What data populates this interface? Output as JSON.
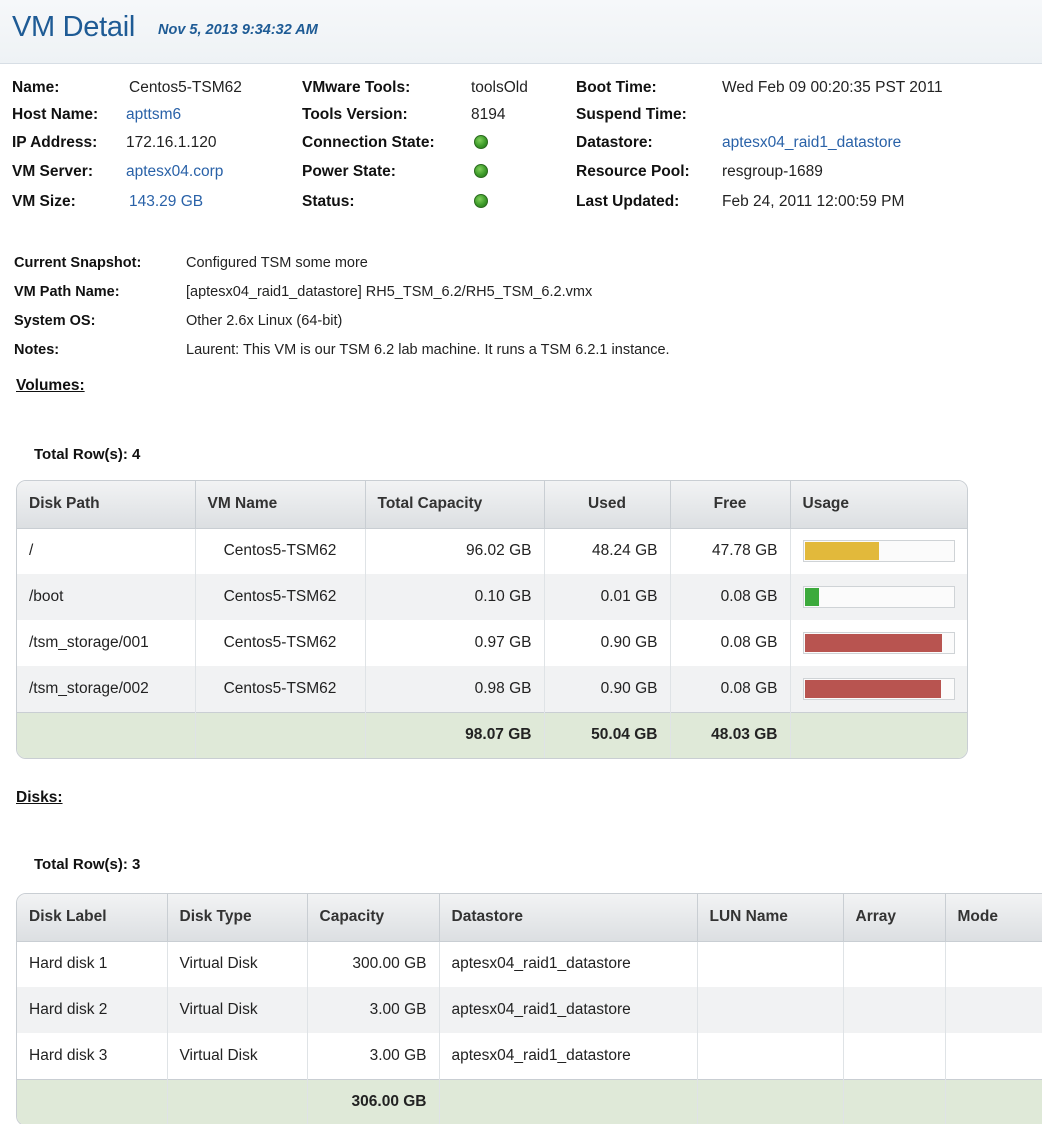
{
  "header": {
    "title": "VM Detail",
    "timestamp": "Nov 5, 2013 9:34:32 AM"
  },
  "details": {
    "col1": [
      {
        "label": "Name:",
        "value": "Centos5-TSM62",
        "link": false
      },
      {
        "label": "Host Name:",
        "value": "apttsm6",
        "link": true
      },
      {
        "label": "IP Address:",
        "value": "172.16.1.120",
        "link": false
      },
      {
        "label": "VM Server:",
        "value": "aptesx04.corp",
        "link": true
      },
      {
        "label": "VM Size:",
        "value": "143.29 GB",
        "link": true
      }
    ],
    "col2": [
      {
        "label": "VMware Tools:",
        "value": "toolsOld"
      },
      {
        "label": "Tools Version:",
        "value": "8194"
      },
      {
        "label": "Connection State:",
        "status": "green"
      },
      {
        "label": "Power State:",
        "status": "green"
      },
      {
        "label": "Status:",
        "status": "green"
      }
    ],
    "col3": [
      {
        "label": "Boot Time:",
        "value": "Wed Feb 09 00:20:35 PST 2011",
        "link": false
      },
      {
        "label": "Suspend Time:",
        "value": "",
        "link": false
      },
      {
        "label": "Datastore:",
        "value": "aptesx04_raid1_datastore",
        "link": true
      },
      {
        "label": "Resource Pool:",
        "value": "resgroup-1689",
        "link": false
      },
      {
        "label": "Last Updated:",
        "value": "Feb 24, 2011 12:00:59 PM",
        "link": false
      }
    ],
    "status_color": "#3d9b2a"
  },
  "extra": [
    {
      "label": "Current Snapshot:",
      "value": "Configured TSM some more"
    },
    {
      "label": "VM Path Name:",
      "value": "[aptesx04_raid1_datastore] RH5_TSM_6.2/RH5_TSM_6.2.vmx"
    },
    {
      "label": "System OS:",
      "value": "Other 2.6x Linux (64-bit)"
    },
    {
      "label": "Notes:",
      "value": "Laurent: This VM is our TSM 6.2 lab machine. It runs a TSM 6.2.1 instance."
    }
  ],
  "volumes": {
    "section_title": "Volumes:",
    "row_count": "Total Row(s): 4",
    "columns": [
      "Disk Path",
      "VM Name",
      "Total Capacity",
      "Used",
      "Free",
      "Usage"
    ],
    "rows": [
      {
        "disk_path": "/",
        "vm_name": "Centos5-TSM62",
        "total": "96.02 GB",
        "used": "48.24 GB",
        "free": "47.78 GB",
        "usage": 0.5,
        "color": "#e2b93b"
      },
      {
        "disk_path": "/boot",
        "vm_name": "Centos5-TSM62",
        "total": "0.10 GB",
        "used": "0.01 GB",
        "free": "0.08 GB",
        "usage": 0.1,
        "color": "#3caa3c"
      },
      {
        "disk_path": "/tsm_storage/001",
        "vm_name": "Centos5-TSM62",
        "total": "0.97 GB",
        "used": "0.90 GB",
        "free": "0.08 GB",
        "usage": 0.93,
        "color": "#b85450"
      },
      {
        "disk_path": "/tsm_storage/002",
        "vm_name": "Centos5-TSM62",
        "total": "0.98 GB",
        "used": "0.90 GB",
        "free": "0.08 GB",
        "usage": 0.92,
        "color": "#b85450"
      }
    ],
    "totals": {
      "total": "98.07 GB",
      "used": "50.04 GB",
      "free": "48.03 GB"
    }
  },
  "disks": {
    "section_title": "Disks:",
    "row_count": "Total Row(s): 3",
    "columns": [
      "Disk Label",
      "Disk Type",
      "Capacity",
      "Datastore",
      "LUN Name",
      "Array",
      "Mode"
    ],
    "rows": [
      {
        "label": "Hard disk 1",
        "type": "Virtual Disk",
        "capacity": "300.00 GB",
        "datastore": "aptesx04_raid1_datastore",
        "lun": "",
        "array": "",
        "mode": ""
      },
      {
        "label": "Hard disk 2",
        "type": "Virtual Disk",
        "capacity": "3.00 GB",
        "datastore": "aptesx04_raid1_datastore",
        "lun": "",
        "array": "",
        "mode": ""
      },
      {
        "label": "Hard disk 3",
        "type": "Virtual Disk",
        "capacity": "3.00 GB",
        "datastore": "aptesx04_raid1_datastore",
        "lun": "",
        "array": "",
        "mode": ""
      }
    ],
    "totals": {
      "capacity": "306.00 GB"
    }
  }
}
